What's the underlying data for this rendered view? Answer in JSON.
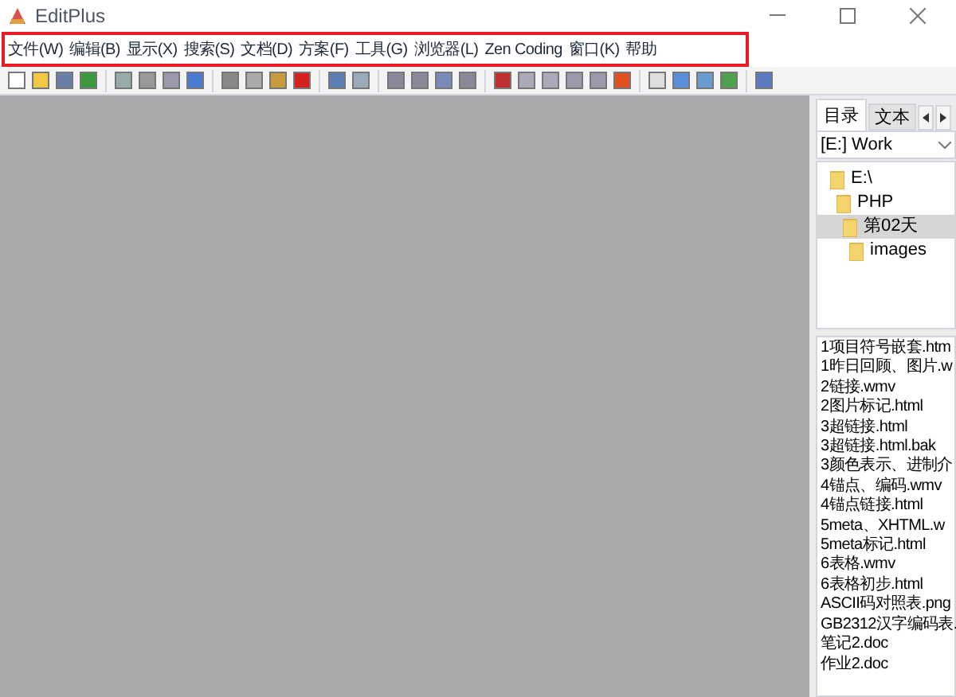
{
  "window": {
    "title": "EditPlus"
  },
  "menu": [
    {
      "label": "文件(W)"
    },
    {
      "label": "编辑(B)"
    },
    {
      "label": "显示(X)"
    },
    {
      "label": "搜索(S)"
    },
    {
      "label": "文档(D)"
    },
    {
      "label": "方案(F)"
    },
    {
      "label": "工具(G)"
    },
    {
      "label": "浏览器(L)"
    },
    {
      "label": "Zen Coding"
    },
    {
      "label": "窗口(K)"
    },
    {
      "label": "帮助"
    }
  ],
  "sidebar": {
    "tabs": [
      {
        "label": "目录",
        "selected": true
      },
      {
        "label": "文本",
        "selected": false
      }
    ],
    "drive": "[E:] Work",
    "tree": [
      {
        "label": "E:\\",
        "selected": false,
        "children": [
          {
            "label": "PHP",
            "selected": false,
            "children": [
              {
                "label": "第02天",
                "selected": true,
                "children": [
                  {
                    "label": "images",
                    "selected": false
                  }
                ]
              }
            ]
          }
        ]
      }
    ],
    "files": [
      "1项目符号嵌套.htm",
      "1昨日回顾、图片.w",
      "2链接.wmv",
      "2图片标记.html",
      "3超链接.html",
      "3超链接.html.bak",
      "3颜色表示、进制介",
      "4锚点、编码.wmv",
      "4锚点链接.html",
      "5meta、XHTML.w",
      "5meta标记.html",
      "6表格.wmv",
      "6表格初步.html",
      "ASCII码对照表.png",
      "GB2312汉字编码表.",
      "笔记2.doc",
      "作业2.doc"
    ]
  }
}
